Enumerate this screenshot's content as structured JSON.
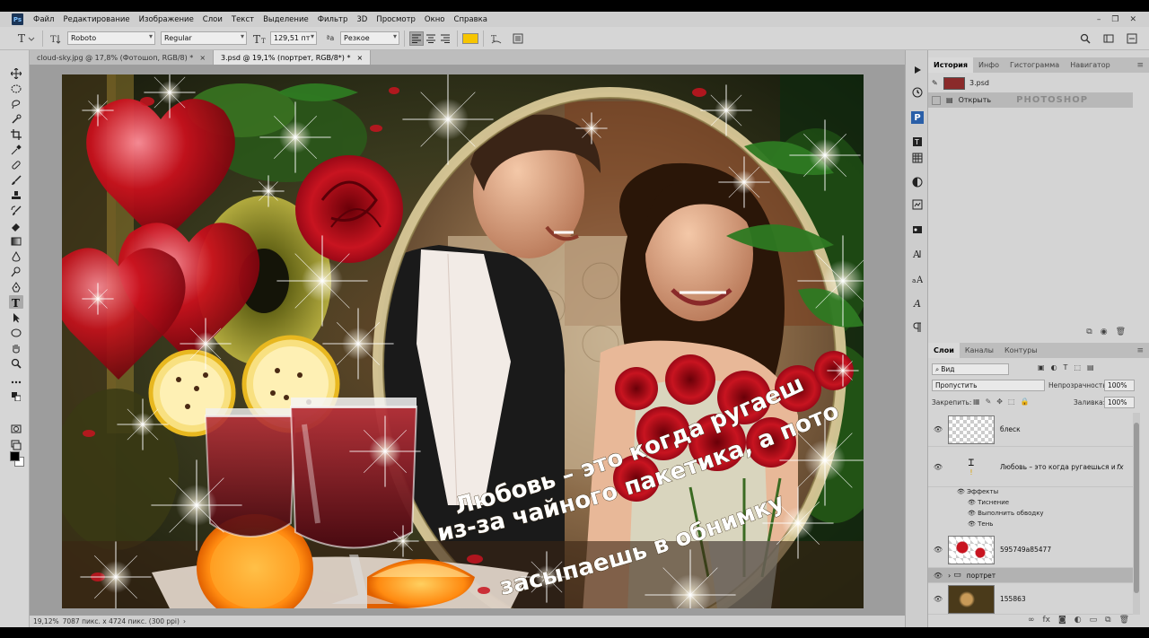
{
  "menu": {
    "logo": "Ps",
    "items": [
      "Файл",
      "Редактирование",
      "Изображение",
      "Слои",
      "Текст",
      "Выделение",
      "Фильтр",
      "3D",
      "Просмотр",
      "Окно",
      "Справка"
    ],
    "window_controls": [
      "–",
      "❐",
      "✕"
    ]
  },
  "options": {
    "font_family": "Roboto",
    "font_style": "Regular",
    "font_size": "129,51 пт",
    "antialias_label": "ªa",
    "antialias": "Резкое",
    "text_color": "#f6c500"
  },
  "tabs": [
    {
      "label": "cloud-sky.jpg @ 17,8% (Фотошоп, RGB/8) *",
      "close": "×"
    },
    {
      "label": "3.psd @ 19,1% (портрет, RGB/8*) *",
      "close": "×"
    }
  ],
  "status": {
    "zoom": "19,12%",
    "doc_info": "7087 пикс. x 4724 пикс. (300 ppi)",
    "arrow": "›"
  },
  "artwork": {
    "text_line1": "Любовь – это когда ругаешься",
    "text_line2": "из-за чайного пакетика, а потом",
    "text_line3": "засыпаешь в обнимку",
    "text_color": "#ffffff"
  },
  "history_panel": {
    "tabs": [
      "История",
      "Инфо",
      "Гистограмма",
      "Навигатор"
    ],
    "menu_icon": "≡",
    "snapshot": "3.psd",
    "steps": [
      {
        "label": "Открыть"
      }
    ],
    "watermark": "PHOTOSHOP"
  },
  "layers_panel": {
    "tabs": [
      "Слои",
      "Каналы",
      "Контуры"
    ],
    "menu_icon": "≡",
    "filter_label": "Вид",
    "blend_mode": "Пропустить",
    "opacity_label": "Непрозрачность:",
    "opacity_value": "100%",
    "lock_label": "Закрепить:",
    "fill_label": "Заливка:",
    "fill_value": "100%",
    "layers": [
      {
        "name": "блеск"
      },
      {
        "name": "Любовь – это когда ругаешься из-...",
        "fx": "fx"
      },
      {
        "name": "595749a85477"
      },
      {
        "name": "портрет"
      },
      {
        "name": "155863"
      }
    ],
    "effects_label": "Эффекты",
    "effects": [
      "Тиснение",
      "Выполнить обводку",
      "Тень"
    ]
  }
}
